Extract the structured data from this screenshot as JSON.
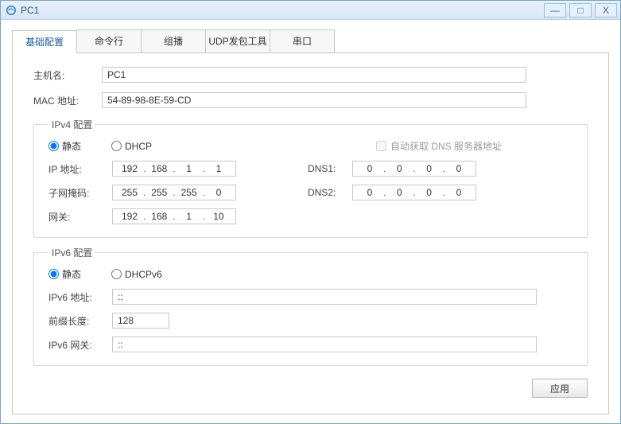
{
  "window": {
    "title": "PC1"
  },
  "win_buttons": {
    "min": "—",
    "max": "□",
    "close": "X"
  },
  "tabs": {
    "basic": "基础配置",
    "cli": "命令行",
    "multicast": "组播",
    "udp": "UDP发包工具",
    "serial": "串口"
  },
  "host": {
    "name_label": "主机名:",
    "name_value": "PC1",
    "mac_label": "MAC 地址:",
    "mac_value": "54-89-98-8E-59-CD"
  },
  "ipv4": {
    "legend": "IPv4 配置",
    "static": "静态",
    "dhcp": "DHCP",
    "auto_dns": "自动获取 DNS 服务器地址",
    "ip_label": "IP 地址:",
    "ip": [
      "192",
      "168",
      "1",
      "1"
    ],
    "mask_label": "子网掩码:",
    "mask": [
      "255",
      "255",
      "255",
      "0"
    ],
    "gw_label": "网关:",
    "gw": [
      "192",
      "168",
      "1",
      "10"
    ],
    "dns1_label": "DNS1:",
    "dns1": [
      "0",
      "0",
      "0",
      "0"
    ],
    "dns2_label": "DNS2:",
    "dns2": [
      "0",
      "0",
      "0",
      "0"
    ]
  },
  "ipv6": {
    "legend": "IPv6 配置",
    "static": "静态",
    "dhcp": "DHCPv6",
    "addr_label": "IPv6 地址:",
    "addr_value": "::",
    "prefix_label": "前缀长度:",
    "prefix_value": "128",
    "gw_label": "IPv6 网关:",
    "gw_value": "::"
  },
  "buttons": {
    "apply": "应用"
  }
}
